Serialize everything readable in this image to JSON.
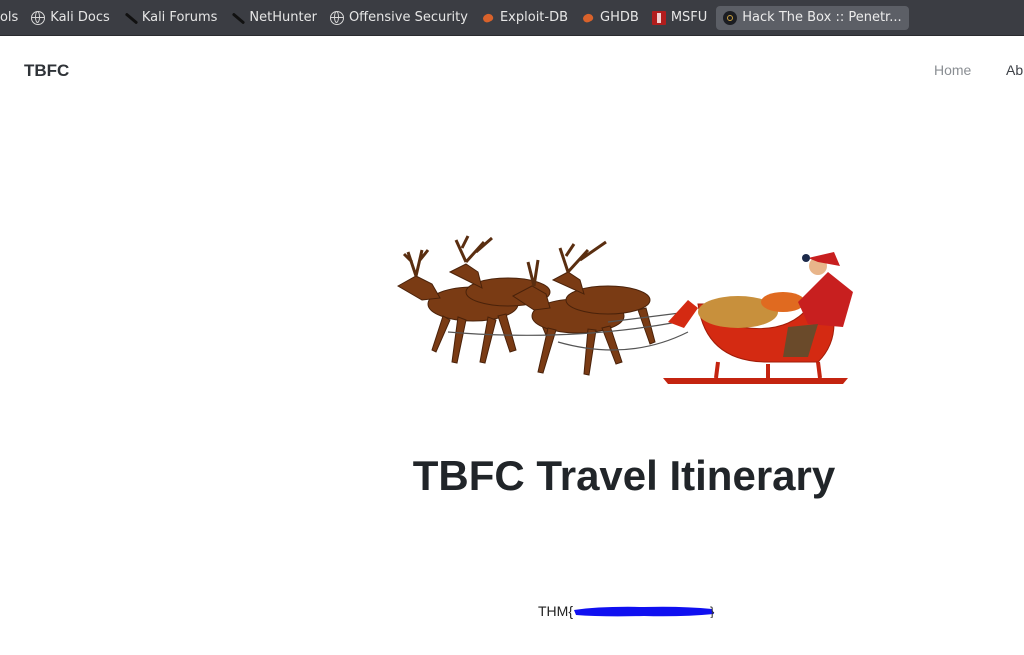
{
  "browser": {
    "bookmarks": [
      {
        "label": "ools",
        "icon": "none"
      },
      {
        "label": "Kali Docs",
        "icon": "globe-icon"
      },
      {
        "label": "Kali Forums",
        "icon": "kali-dragon-icon"
      },
      {
        "label": "NetHunter",
        "icon": "kali-dragon-icon"
      },
      {
        "label": "Offensive Security",
        "icon": "globe-icon"
      },
      {
        "label": "Exploit-DB",
        "icon": "exploit-db-icon"
      },
      {
        "label": "GHDB",
        "icon": "exploit-db-icon"
      },
      {
        "label": "MSFU",
        "icon": "msfu-icon"
      },
      {
        "label": "Hack The Box :: Penetr...",
        "icon": "htb-icon",
        "active": true
      }
    ]
  },
  "navbar": {
    "brand": "TBFC",
    "links": [
      "Home",
      "Ab"
    ]
  },
  "main": {
    "image": "santa-sleigh-with-reindeer",
    "title": "TBFC Travel Itinerary",
    "flag_prefix": "THM{",
    "flag_suffix": "}",
    "redaction_color": "#1010f0"
  }
}
